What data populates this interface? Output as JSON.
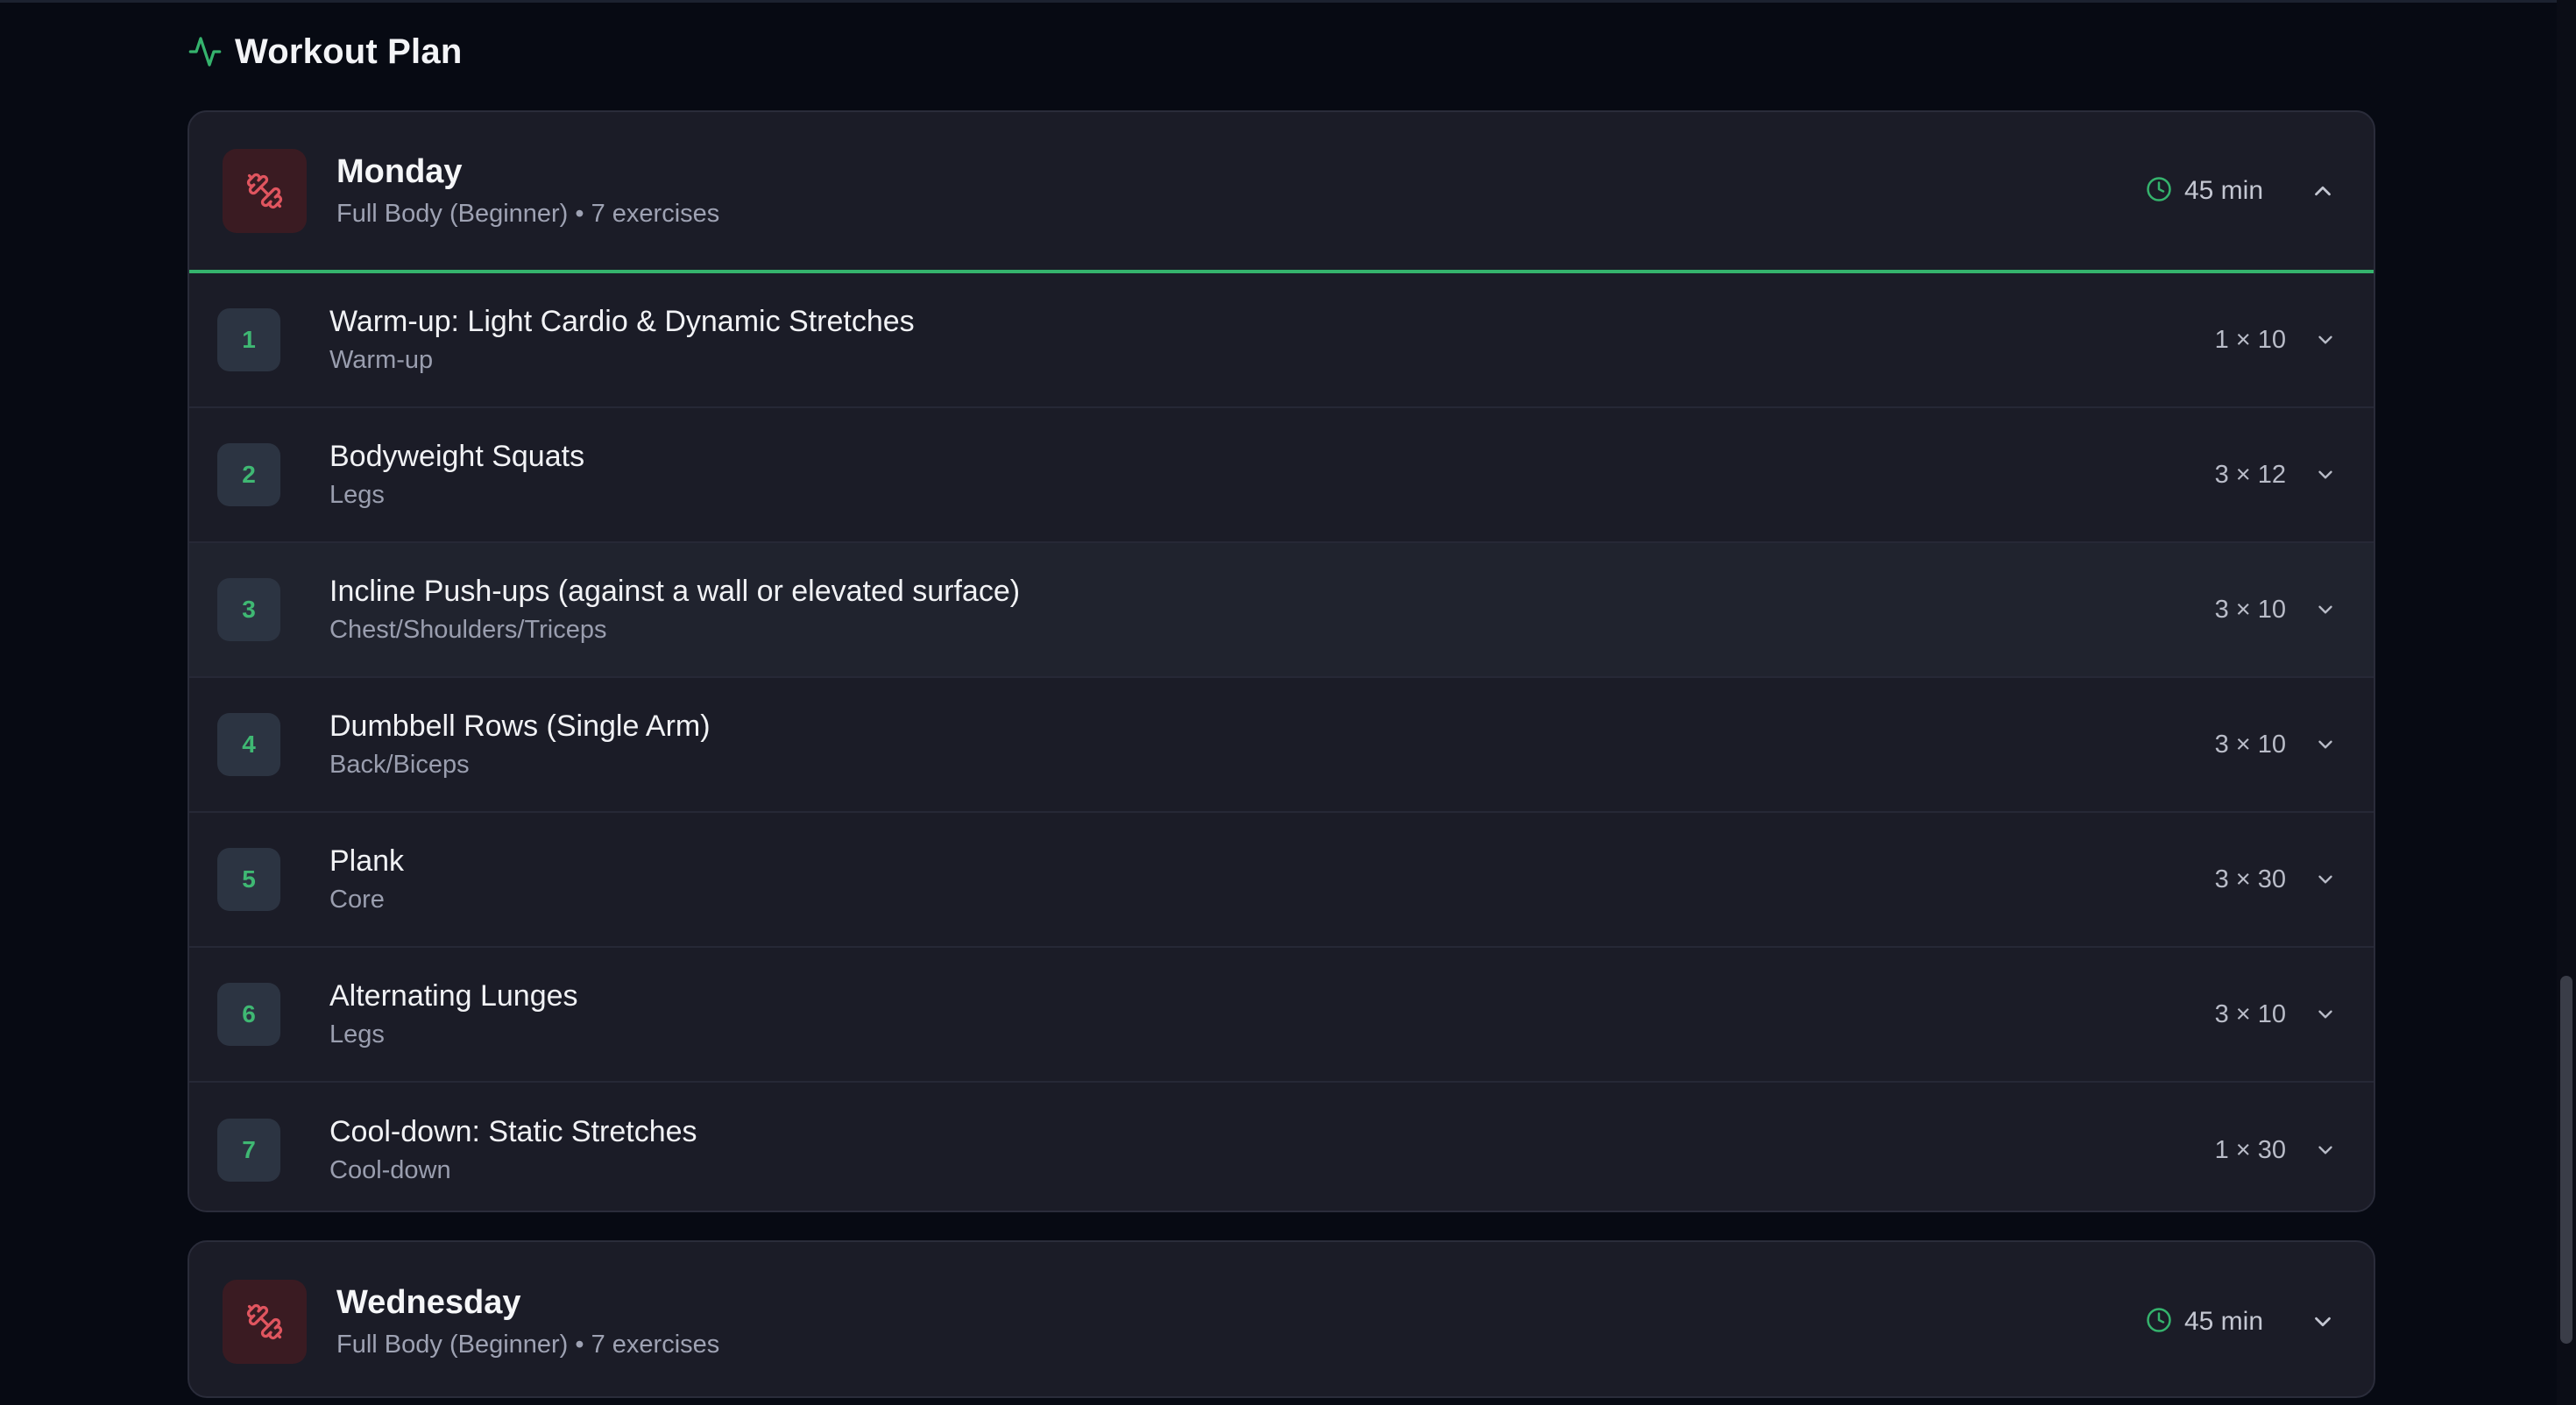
{
  "section": {
    "title": "Workout Plan",
    "icon": "activity-icon",
    "accent_color": "#35b36d"
  },
  "days": [
    {
      "name": "Monday",
      "subtitle": "Full Body (Beginner) • 7 exercises",
      "duration": "45 min",
      "icon": "dumbbell-icon",
      "expanded": true,
      "exercises": [
        {
          "number": "1",
          "name": "Warm-up: Light Cardio & Dynamic Stretches",
          "category": "Warm-up",
          "sets": "1 × 10"
        },
        {
          "number": "2",
          "name": "Bodyweight Squats",
          "category": "Legs",
          "sets": "3 × 12"
        },
        {
          "number": "3",
          "name": "Incline Push-ups (against a wall or elevated surface)",
          "category": "Chest/Shoulders/Triceps",
          "sets": "3 × 10"
        },
        {
          "number": "4",
          "name": "Dumbbell Rows (Single Arm)",
          "category": "Back/Biceps",
          "sets": "3 × 10"
        },
        {
          "number": "5",
          "name": "Plank",
          "category": "Core",
          "sets": "3 × 30"
        },
        {
          "number": "6",
          "name": "Alternating Lunges",
          "category": "Legs",
          "sets": "3 × 10"
        },
        {
          "number": "7",
          "name": "Cool-down: Static Stretches",
          "category": "Cool-down",
          "sets": "1 × 30"
        }
      ]
    },
    {
      "name": "Wednesday",
      "subtitle": "Full Body (Beginner) • 7 exercises",
      "duration": "45 min",
      "icon": "dumbbell-icon",
      "expanded": false
    }
  ]
}
